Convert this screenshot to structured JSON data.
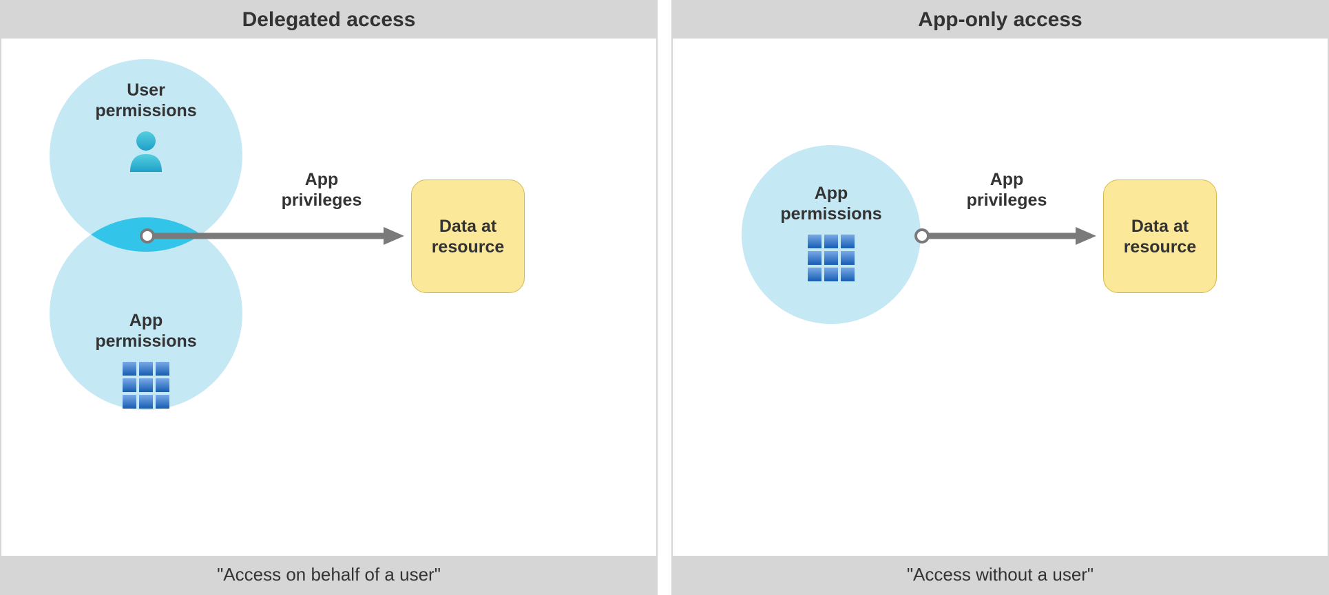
{
  "left": {
    "title": "Delegated access",
    "footer": "\"Access on behalf of a user\"",
    "user_perm_line1": "User",
    "user_perm_line2": "permissions",
    "app_perm_line1": "App",
    "app_perm_line2": "permissions",
    "arrow_label_line1": "App",
    "arrow_label_line2": "privileges",
    "data_line1": "Data at",
    "data_line2": "resource"
  },
  "right": {
    "title": "App-only access",
    "footer": "\"Access without a user\"",
    "app_perm_line1": "App",
    "app_perm_line2": "permissions",
    "arrow_label_line1": "App",
    "arrow_label_line2": "privileges",
    "data_line1": "Data at",
    "data_line2": "resource"
  },
  "colors": {
    "circle_fill": "#c5e8f5",
    "intersection": "#32c5e9",
    "data_box": "#fbe899",
    "arrow": "#7a7a7a",
    "user_icon_top": "#55d0e0",
    "user_icon_bottom": "#1f9fc7",
    "grid_top": "#7aa9e6",
    "grid_bottom": "#165db3"
  }
}
